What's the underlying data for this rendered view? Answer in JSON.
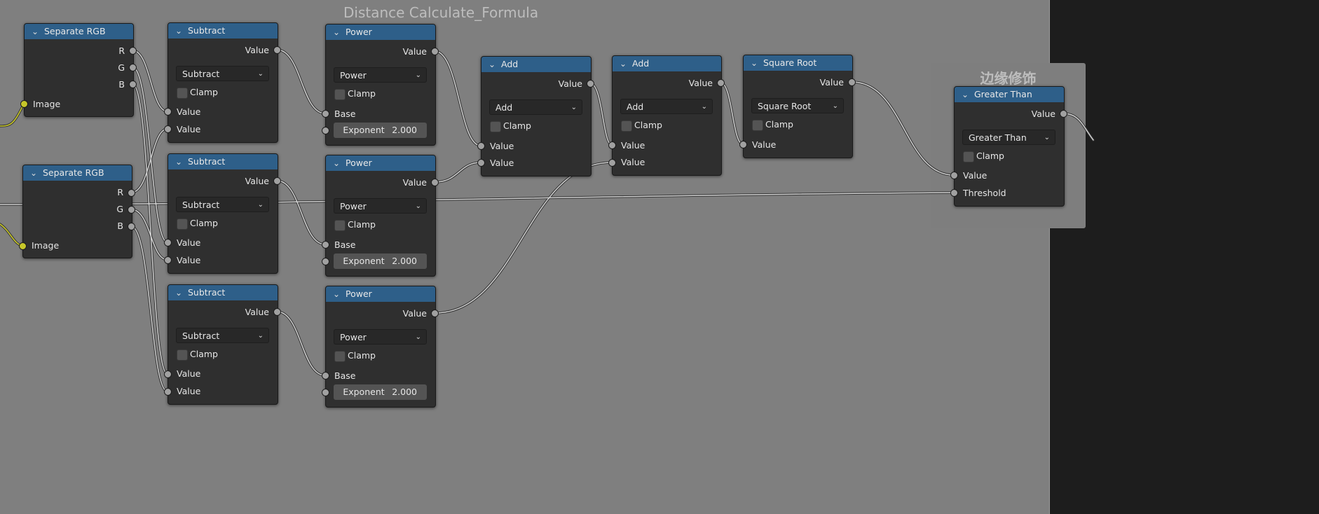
{
  "frames": {
    "main_title": "Distance Calculate_Formula",
    "edge_title": "边缘修饰"
  },
  "common": {
    "value": "Value",
    "clamp": "Clamp",
    "image": "Image",
    "base": "Base",
    "threshold": "Threshold",
    "exponent": "Exponent",
    "r": "R",
    "g": "G",
    "b": "B"
  },
  "nodes": {
    "separate_rgb_1": {
      "title": "Separate RGB"
    },
    "separate_rgb_2": {
      "title": "Separate RGB"
    },
    "subtract_1": {
      "title": "Subtract",
      "operation": "Subtract"
    },
    "subtract_2": {
      "title": "Subtract",
      "operation": "Subtract"
    },
    "subtract_3": {
      "title": "Subtract",
      "operation": "Subtract"
    },
    "power_1": {
      "title": "Power",
      "operation": "Power",
      "exponent_value": "2.000"
    },
    "power_2": {
      "title": "Power",
      "operation": "Power",
      "exponent_value": "2.000"
    },
    "power_3": {
      "title": "Power",
      "operation": "Power",
      "exponent_value": "2.000"
    },
    "add_1": {
      "title": "Add",
      "operation": "Add"
    },
    "add_2": {
      "title": "Add",
      "operation": "Add"
    },
    "square_root": {
      "title": "Square Root",
      "operation": "Square Root"
    },
    "greater_than": {
      "title": "Greater Than",
      "operation": "Greater Than"
    }
  },
  "colors": {
    "node_header": "#2e5f89",
    "node_body": "#2f2f2f",
    "frame": "#7f7f7f",
    "canvas": "#1d1d1d",
    "socket_float": "#a1a1a1",
    "socket_color": "#c7c729",
    "link": "#d0d0d0"
  }
}
